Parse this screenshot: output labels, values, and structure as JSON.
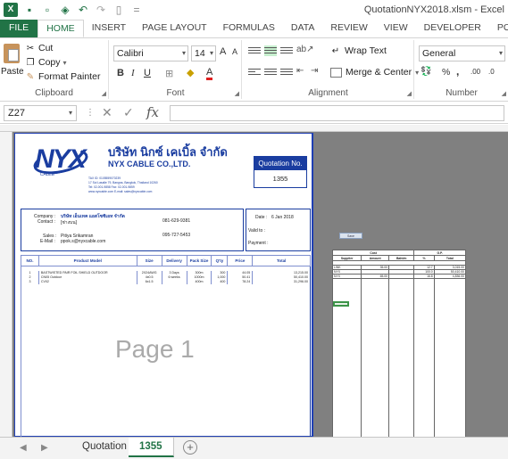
{
  "window": {
    "title": "QuotationNYX2018.xlsm - Excel",
    "app_icon": "X"
  },
  "ribbon": {
    "tabs": [
      "FILE",
      "HOME",
      "INSERT",
      "PAGE LAYOUT",
      "FORMULAS",
      "DATA",
      "REVIEW",
      "VIEW",
      "DEVELOPER",
      "POWERPIVOT"
    ],
    "active_tab": "HOME",
    "clipboard": {
      "paste": "Paste",
      "cut": "Cut",
      "copy": "Copy",
      "format_painter": "Format Painter",
      "label": "Clipboard"
    },
    "font": {
      "name": "Calibri",
      "size": "14",
      "bold": "B",
      "italic": "I",
      "underline": "U",
      "grow": "A",
      "shrink": "A",
      "color_a": "A",
      "label": "Font"
    },
    "alignment": {
      "wrap_text": "Wrap Text",
      "merge_center": "Merge & Center",
      "label": "Alignment"
    },
    "number": {
      "format": "General",
      "percent": "%",
      "comma": ",",
      "inc_decimal": ".00",
      "dec_decimal": ".0",
      "label": "Number"
    }
  },
  "formula_bar": {
    "name_box": "Z27",
    "fx": "fx",
    "value": ""
  },
  "sheet": {
    "company_th": "บริษัท นิกซ์ เคเบิ้ล จำกัด",
    "company_en": "NYX CABLE CO.,LTD.",
    "company_info": [
      "TAX ID: 0105559070239",
      "17 Soi Lasalle 79, Bangna, Bangkok, Thailand 10260",
      "Tel: 02-001-9858 Fax: 02-001-9859",
      "www.nyxcable.com E-mail: sales@nyxcable.com"
    ],
    "logo_sub": "CABLE",
    "quotation_label": "Quotation No.",
    "quotation_no": "1355",
    "customer": {
      "company_label": "Company :",
      "company": "บริษัท เอ็นเทค แอสโซซิเอท จำกัด",
      "contact_label": "Contact :",
      "contact": "[ช่างบน]",
      "phone": "081-629-9381",
      "sales_label": "Sales :",
      "sales": "Pitiya Srikamran",
      "sales_phone": "095-727-5453",
      "email_label": "E-Mail :",
      "email": "ppok.s@nyxcable.com"
    },
    "terms": {
      "date_label": "Date :",
      "date": "6 Jan 2018",
      "valid_label": "Valid to :",
      "payment_label": "Payment :"
    },
    "table": {
      "headers": [
        "NO.",
        "Product Model",
        "Size",
        "Delivery",
        "Pack Size",
        "Q'ty",
        "Price",
        "Total"
      ],
      "rows": [
        [
          "1",
          "BASTWISTED PAIR FOIL SHIELD OUTDOOR",
          "2X24AWG",
          "3 Days",
          "300m",
          "300",
          "44.05",
          "13,215.00"
        ],
        [
          "2",
          "CN05 Outdoor",
          "4x0.5",
          "6 weeks",
          "1000m",
          "1,000",
          "50.41",
          "50,410.00"
        ],
        [
          "3",
          "CV02",
          "6x1.5",
          "",
          "400m",
          "400",
          "78.24",
          "31,296.00"
        ]
      ]
    },
    "watermark": "Page 1"
  },
  "calc": {
    "button": "Save",
    "group_headers": [
      "Cost",
      "G.P."
    ],
    "headers": [
      "Supplier",
      "Amount",
      "Baht/m",
      "%",
      "Total"
    ],
    "rows": [
      [
        "LINK",
        "35.00",
        "12.7",
        "3,015.00"
      ],
      [
        "NYX",
        "",
        "100.0",
        "50,410.00"
      ],
      [
        "NYX",
        "65.00",
        "16.8",
        "4,836.00"
      ]
    ]
  },
  "sheet_tabs": [
    "Quotation",
    "1355"
  ],
  "active_sheet": "1355",
  "colors": {
    "excel_green": "#217346",
    "brand_blue": "#1a3da0"
  }
}
